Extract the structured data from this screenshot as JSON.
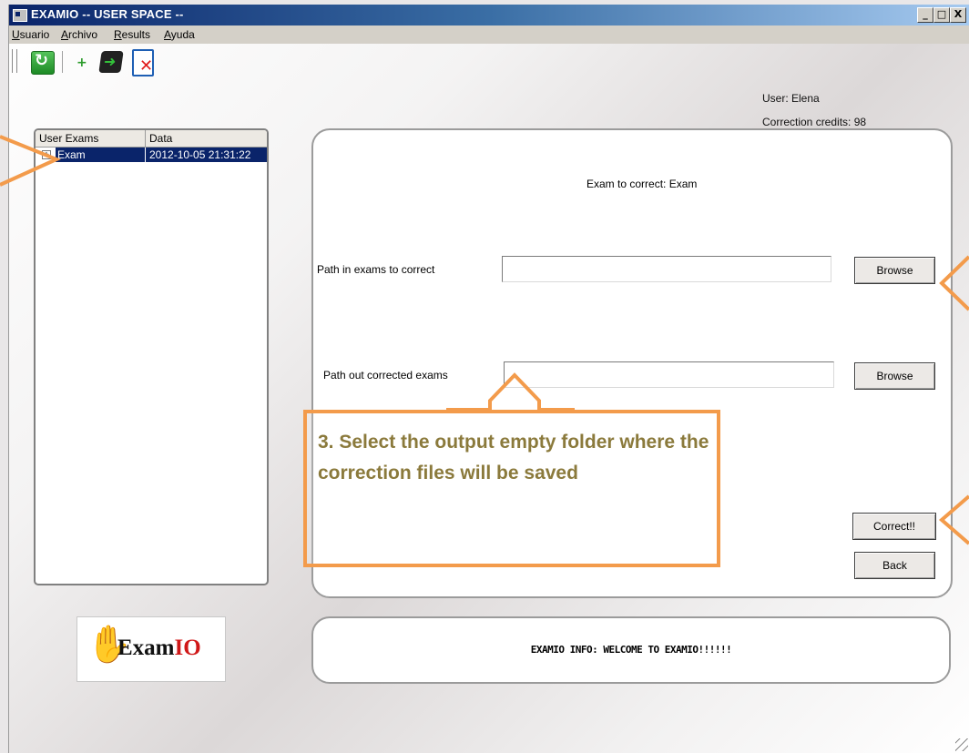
{
  "window": {
    "title": "EXAMIO -- USER SPACE --",
    "controls": {
      "minimize": "_",
      "maximize": "□",
      "close": "X"
    }
  },
  "menu": [
    {
      "label": "Usuario"
    },
    {
      "label": "Archivo"
    },
    {
      "label": "Results"
    },
    {
      "label": "Ayuda"
    }
  ],
  "toolbar": {
    "icons": [
      "refresh-icon",
      "add-icon",
      "import-icon",
      "delete-icon"
    ]
  },
  "user": {
    "name_line": "User: Elena",
    "credits_line": "Correction credits: 98"
  },
  "exam_list": {
    "columns": [
      "User Exams",
      "Data"
    ],
    "rows": [
      {
        "expander": "+",
        "name": "Exam",
        "date": "2012-10-05 21:31:22",
        "selected": true
      }
    ]
  },
  "logo": {
    "hand": "✋",
    "text_main": "Exam",
    "text_accent": "IO"
  },
  "correct_panel": {
    "heading": "Exam to correct: Exam",
    "path_in_label": "Path in exams to correct",
    "path_in_value": "",
    "path_out_label": "Path out corrected exams",
    "path_out_value": "",
    "browse_label": "Browse",
    "browse_out_label": "Browse",
    "correct_label": "Correct!!",
    "back_label": "Back"
  },
  "info": {
    "text": "EXAMIO INFO: WELCOME TO EXAMIO!!!!!!"
  },
  "annotation": {
    "text": "3. Select the output empty folder where the correction files will be saved",
    "color": "#f39b4b",
    "text_color": "#8b7a3c"
  },
  "colors": {
    "title_bar": "#0a246a",
    "selection": "#0a246a",
    "annotation_border": "#f39b4b"
  }
}
